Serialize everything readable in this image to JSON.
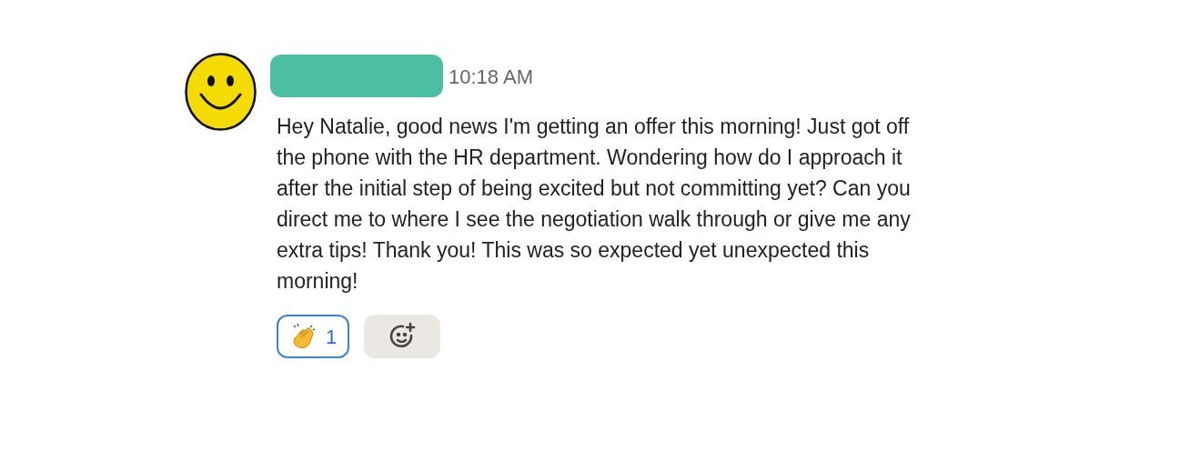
{
  "message": {
    "time": "10:18 AM",
    "text": "Hey Natalie, good news I'm getting an offer this morning! Just got off the phone with the HR department. Wondering how do I approach it after the initial step of being excited but not committing yet? Can you direct me to where I see the negotiation walk through or give me any extra tips! Thank you! This was so expected yet unexpected this morning!",
    "reactions": [
      {
        "kind": "clap",
        "count": "1",
        "selected": true
      }
    ]
  }
}
